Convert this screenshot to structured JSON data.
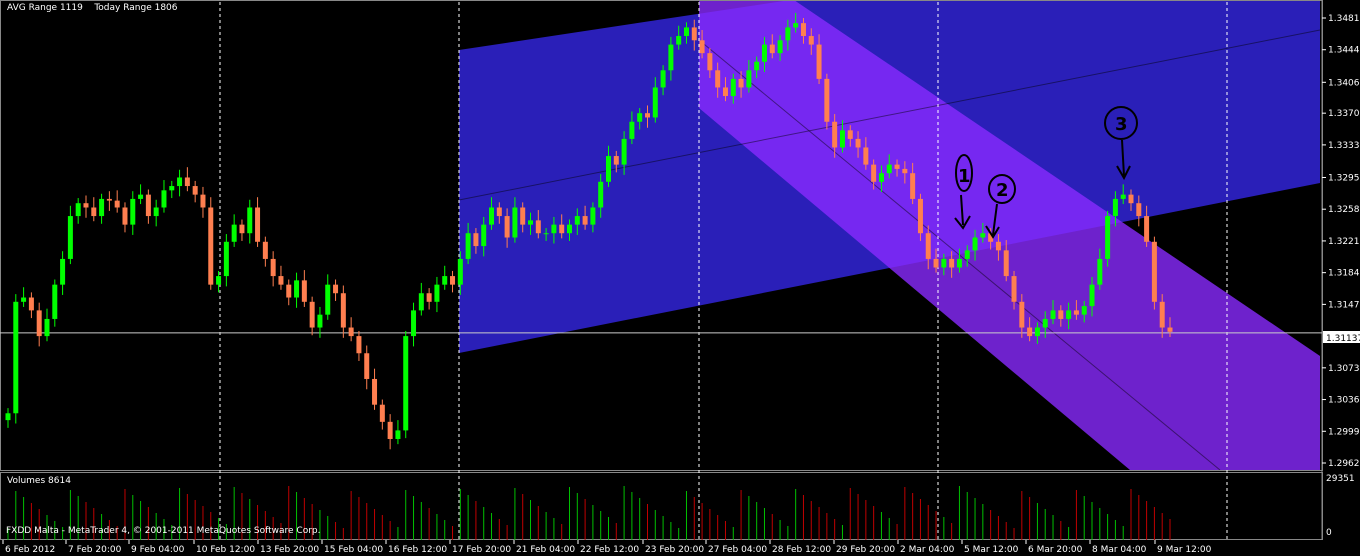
{
  "header": {
    "avg_range_label": "AVG Range 1119",
    "today_range_label": "Today Range 1806"
  },
  "volume_panel": {
    "label": "Volumes 8614",
    "max_label": "29351",
    "min_label": "0"
  },
  "footer": {
    "copyright": "FXDD Malta - MetaTrader 4, © 2001-2011 MetaQuotes Software Corp."
  },
  "colors": {
    "background": "#000000",
    "bull": "#00ff00",
    "bear": "#ff7f50",
    "upper_channel": "#3a2bff",
    "lower_channel": "#8a2bff",
    "grid": "#ffffff",
    "volume_up": "#00c000",
    "volume_down": "#c00000"
  },
  "annotations": [
    "1",
    "2",
    "3"
  ],
  "chart_data": {
    "type": "candlestick",
    "title": "",
    "ylim": [
      1.2962,
      1.3481
    ],
    "y_ticks": [
      "1.34810",
      "1.34440",
      "1.34060",
      "1.33700",
      "1.33330",
      "1.32950",
      "1.32580",
      "1.32210",
      "1.31840",
      "1.31470",
      "1.31137",
      "1.30730",
      "1.30360",
      "1.29990",
      "1.29620"
    ],
    "current_price": "1.31137",
    "x_ticks": [
      "6 Feb 2012",
      "7 Feb 20:00",
      "9 Feb 04:00",
      "10 Feb 12:00",
      "13 Feb 20:00",
      "15 Feb 04:00",
      "16 Feb 12:00",
      "17 Feb 20:00",
      "21 Feb 04:00",
      "22 Feb 12:00",
      "23 Feb 20:00",
      "27 Feb 04:00",
      "28 Feb 12:00",
      "29 Feb 20:00",
      "2 Mar 04:00",
      "5 Mar 12:00",
      "6 Mar 20:00",
      "8 Mar 04:00",
      "9 Mar 12:00"
    ],
    "closes": [
      1.302,
      1.315,
      1.3155,
      1.314,
      1.311,
      1.313,
      1.317,
      1.32,
      1.325,
      1.3265,
      1.326,
      1.325,
      1.327,
      1.3268,
      1.326,
      1.324,
      1.327,
      1.3275,
      1.325,
      1.326,
      1.328,
      1.3285,
      1.3295,
      1.3285,
      1.3275,
      1.326,
      1.317,
      1.318,
      1.322,
      1.324,
      1.323,
      1.326,
      1.322,
      1.32,
      1.318,
      1.317,
      1.3155,
      1.3175,
      1.315,
      1.312,
      1.3135,
      1.317,
      1.316,
      1.312,
      1.311,
      1.309,
      1.306,
      1.303,
      1.301,
      1.299,
      1.3,
      1.311,
      1.314,
      1.316,
      1.315,
      1.317,
      1.318,
      1.317,
      1.32,
      1.323,
      1.3215,
      1.324,
      1.326,
      1.325,
      1.3225,
      1.326,
      1.324,
      1.3245,
      1.323,
      1.323,
      1.324,
      1.323,
      1.324,
      1.325,
      1.324,
      1.326,
      1.329,
      1.332,
      1.331,
      1.334,
      1.336,
      1.337,
      1.3365,
      1.34,
      1.342,
      1.345,
      1.346,
      1.347,
      1.3455,
      1.344,
      1.342,
      1.34,
      1.339,
      1.341,
      1.34,
      1.342,
      1.343,
      1.345,
      1.344,
      1.3455,
      1.347,
      1.3475,
      1.346,
      1.345,
      1.341,
      1.336,
      1.333,
      1.335,
      1.334,
      1.333,
      1.331,
      1.329,
      1.33,
      1.331,
      1.3305,
      1.33,
      1.327,
      1.323,
      1.32,
      1.319,
      1.32,
      1.319,
      1.32,
      1.321,
      1.3225,
      1.323,
      1.322,
      1.321,
      1.318,
      1.315,
      1.312,
      1.311,
      1.312,
      1.313,
      1.314,
      1.313,
      1.314,
      1.3135,
      1.3145,
      1.317,
      1.32,
      1.325,
      1.327,
      1.3275,
      1.3265,
      1.325,
      1.322,
      1.315,
      1.312,
      1.3115
    ]
  }
}
